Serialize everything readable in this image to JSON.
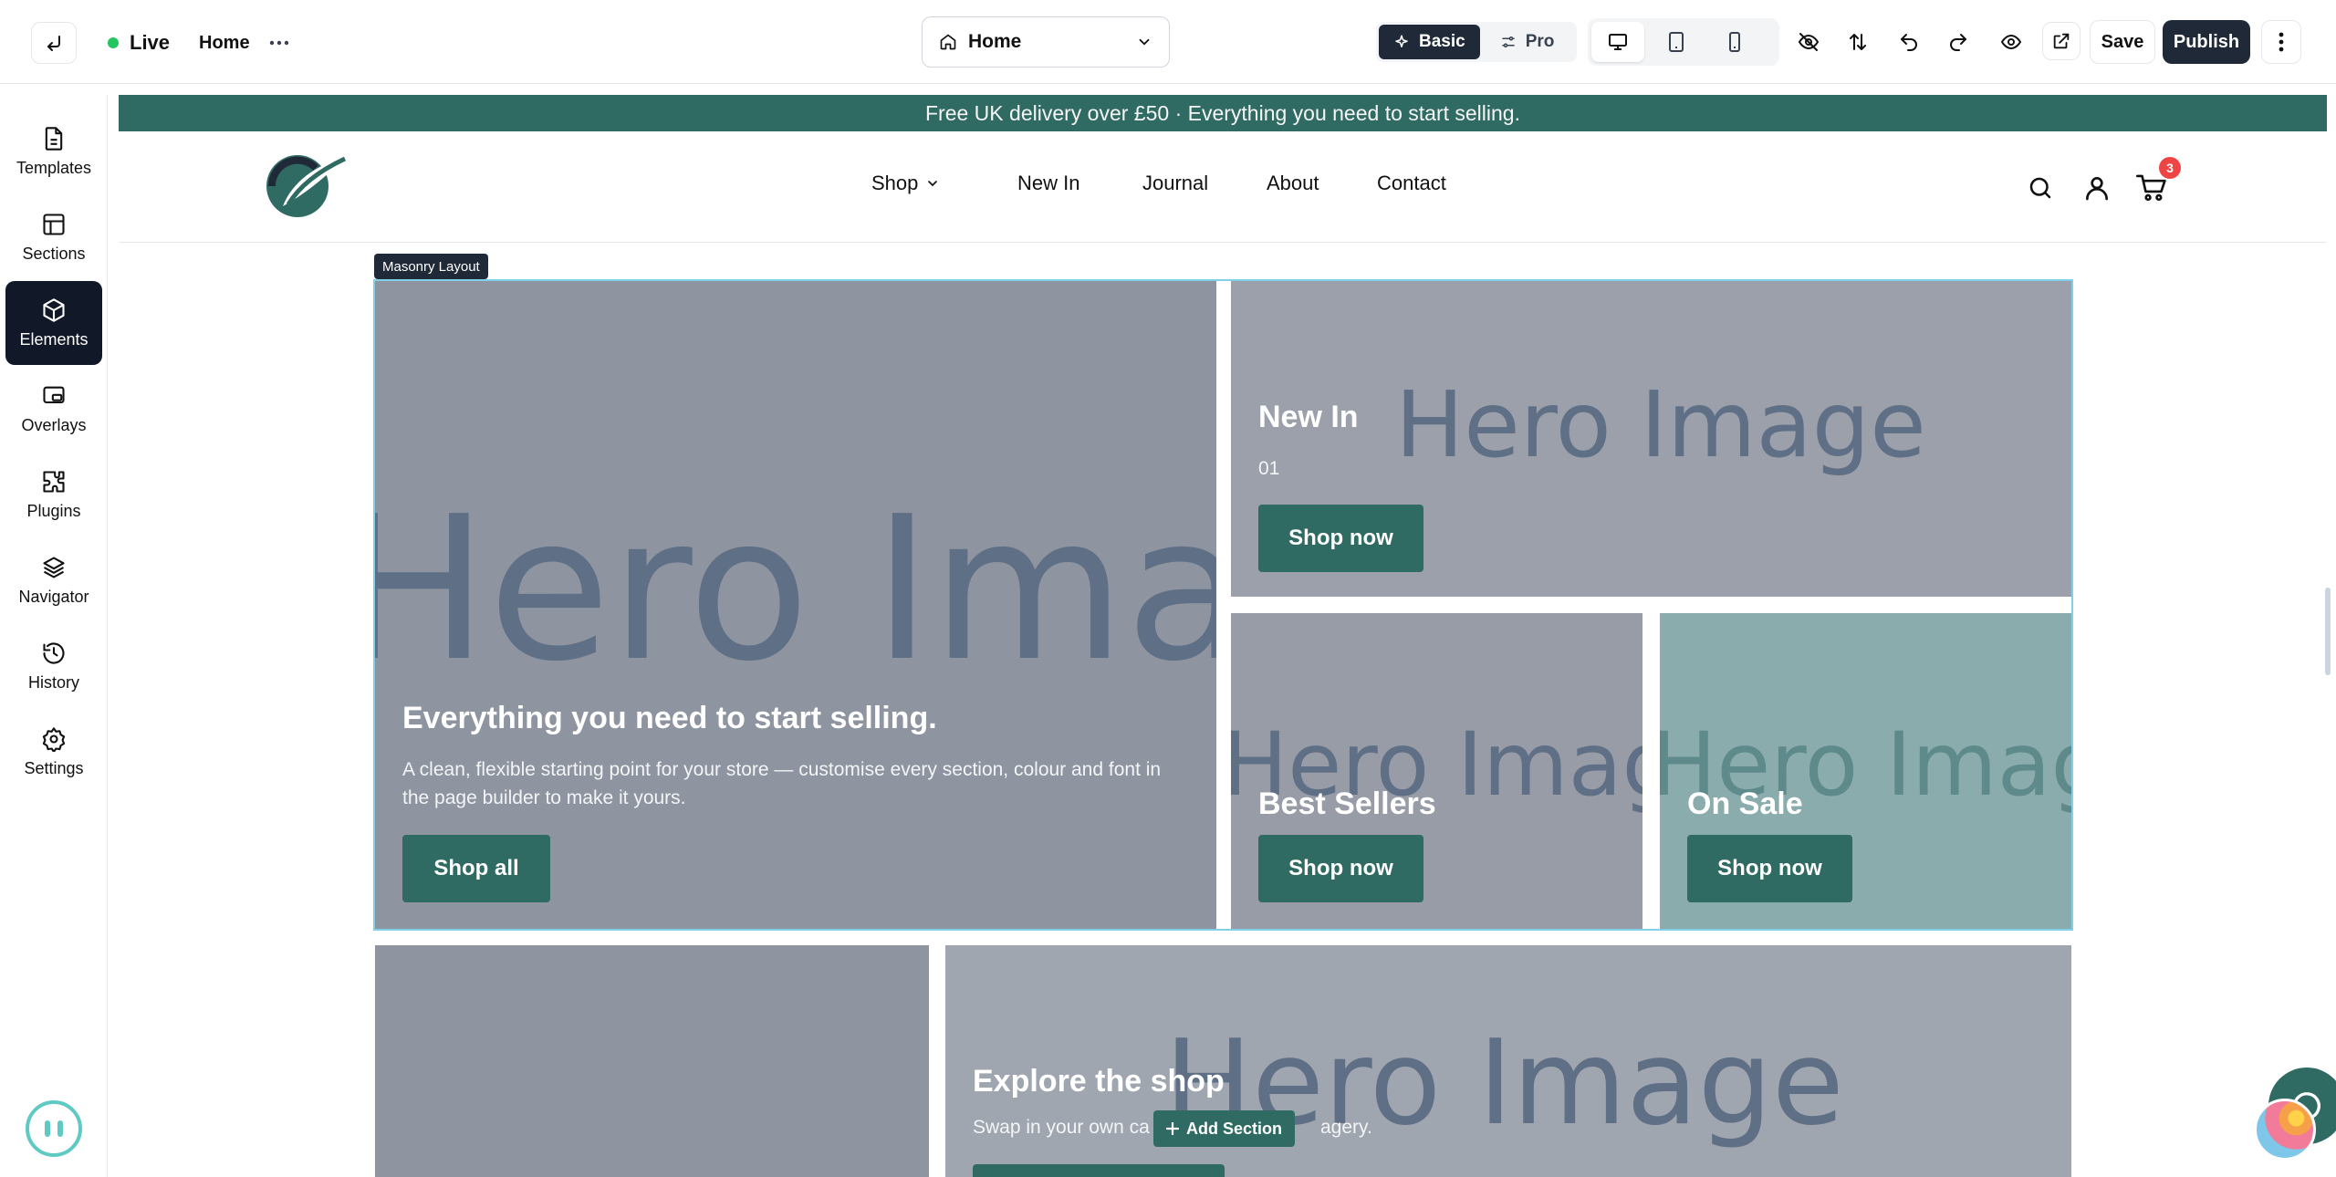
{
  "topbar": {
    "status_label": "Live",
    "page_link": "Home",
    "page_select_value": "Home",
    "mode_basic": "Basic",
    "mode_pro": "Pro",
    "save_label": "Save",
    "publish_label": "Publish"
  },
  "sidebar": {
    "items": [
      {
        "label": "Templates",
        "icon": "file-icon"
      },
      {
        "label": "Sections",
        "icon": "layout-icon"
      },
      {
        "label": "Elements",
        "icon": "cube-icon"
      },
      {
        "label": "Overlays",
        "icon": "overlay-icon"
      },
      {
        "label": "Plugins",
        "icon": "puzzle-icon"
      },
      {
        "label": "Navigator",
        "icon": "layers-icon"
      },
      {
        "label": "History",
        "icon": "history-icon"
      },
      {
        "label": "Settings",
        "icon": "gear-icon"
      }
    ],
    "active": "Elements"
  },
  "site": {
    "announcement": "Free UK delivery over £50 · Everything you need to start selling.",
    "nav": [
      "Shop",
      "New In",
      "Journal",
      "About",
      "Contact"
    ],
    "cart_count": "3",
    "brand_color": "#2f6b62"
  },
  "masonry": {
    "tag": "Masonry Layout",
    "placeholder": "Hero Image",
    "main": {
      "title": "Everything you need to start selling.",
      "text": "A clean, flexible starting point for your store — customise every section, colour and font in the page builder to make it yours.",
      "button": "Shop all"
    },
    "new_in": {
      "title": "New In",
      "number": "01",
      "button": "Shop now"
    },
    "best_sellers": {
      "title": "Best Sellers",
      "button": "Shop now"
    },
    "on_sale": {
      "title": "On Sale",
      "button": "Shop now"
    }
  },
  "explore": {
    "title": "Explore the shop",
    "text_left": "Swap in your own ca",
    "text_right": "agery."
  },
  "add_section_label": "Add Section"
}
